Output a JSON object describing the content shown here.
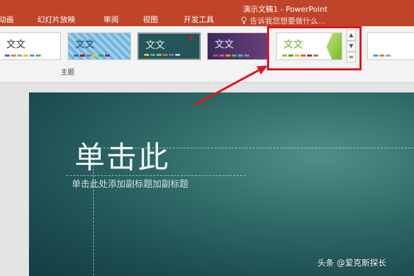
{
  "window": {
    "title": "演示文稿1 - PowerPoint"
  },
  "tabs": [
    "动画",
    "幻灯片放映",
    "审阅",
    "视图",
    "开发工具"
  ],
  "tell_me": {
    "placeholder": "告诉我您想要做什么..."
  },
  "design": {
    "group_label": "主题",
    "themes": [
      {
        "label": "文文",
        "style": "office",
        "selected": false
      },
      {
        "label": "文文",
        "style": "pattern",
        "selected": false
      },
      {
        "label": "文文",
        "style": "dark-teal",
        "selected": true
      },
      {
        "label": "文文",
        "style": "purple",
        "selected": false
      },
      {
        "label": "文文",
        "style": "green-facet",
        "selected": false,
        "highlighted": true
      },
      {
        "label": "",
        "style": "plain",
        "selected": false
      }
    ]
  },
  "slide": {
    "title": "单击此",
    "subtitle": "单击此处添加副标题加副标题"
  },
  "watermark": {
    "text": "头条 @爱克斯探长"
  },
  "colors": {
    "ribbon_header": "#c0442a",
    "highlight": "#e0141e",
    "slide_bg": "#2f6a67"
  }
}
